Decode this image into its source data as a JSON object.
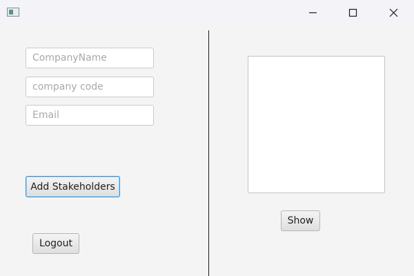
{
  "window": {
    "icons": {
      "app": "app-window-icon",
      "minimize": "minimize-icon",
      "maximize": "maximize-icon",
      "close": "close-icon"
    }
  },
  "form": {
    "company_name": {
      "value": "",
      "placeholder": "CompanyName"
    },
    "company_code": {
      "value": "",
      "placeholder": "company code"
    },
    "email": {
      "value": "",
      "placeholder": "Email"
    },
    "add_button_label": "Add Stakeholders",
    "logout_button_label": "Logout"
  },
  "right_panel": {
    "list_items": [],
    "show_button_label": "Show"
  },
  "colors": {
    "focus_border": "#2a94e0",
    "divider": "#1a1a1a",
    "background": "#f4f4f4"
  }
}
